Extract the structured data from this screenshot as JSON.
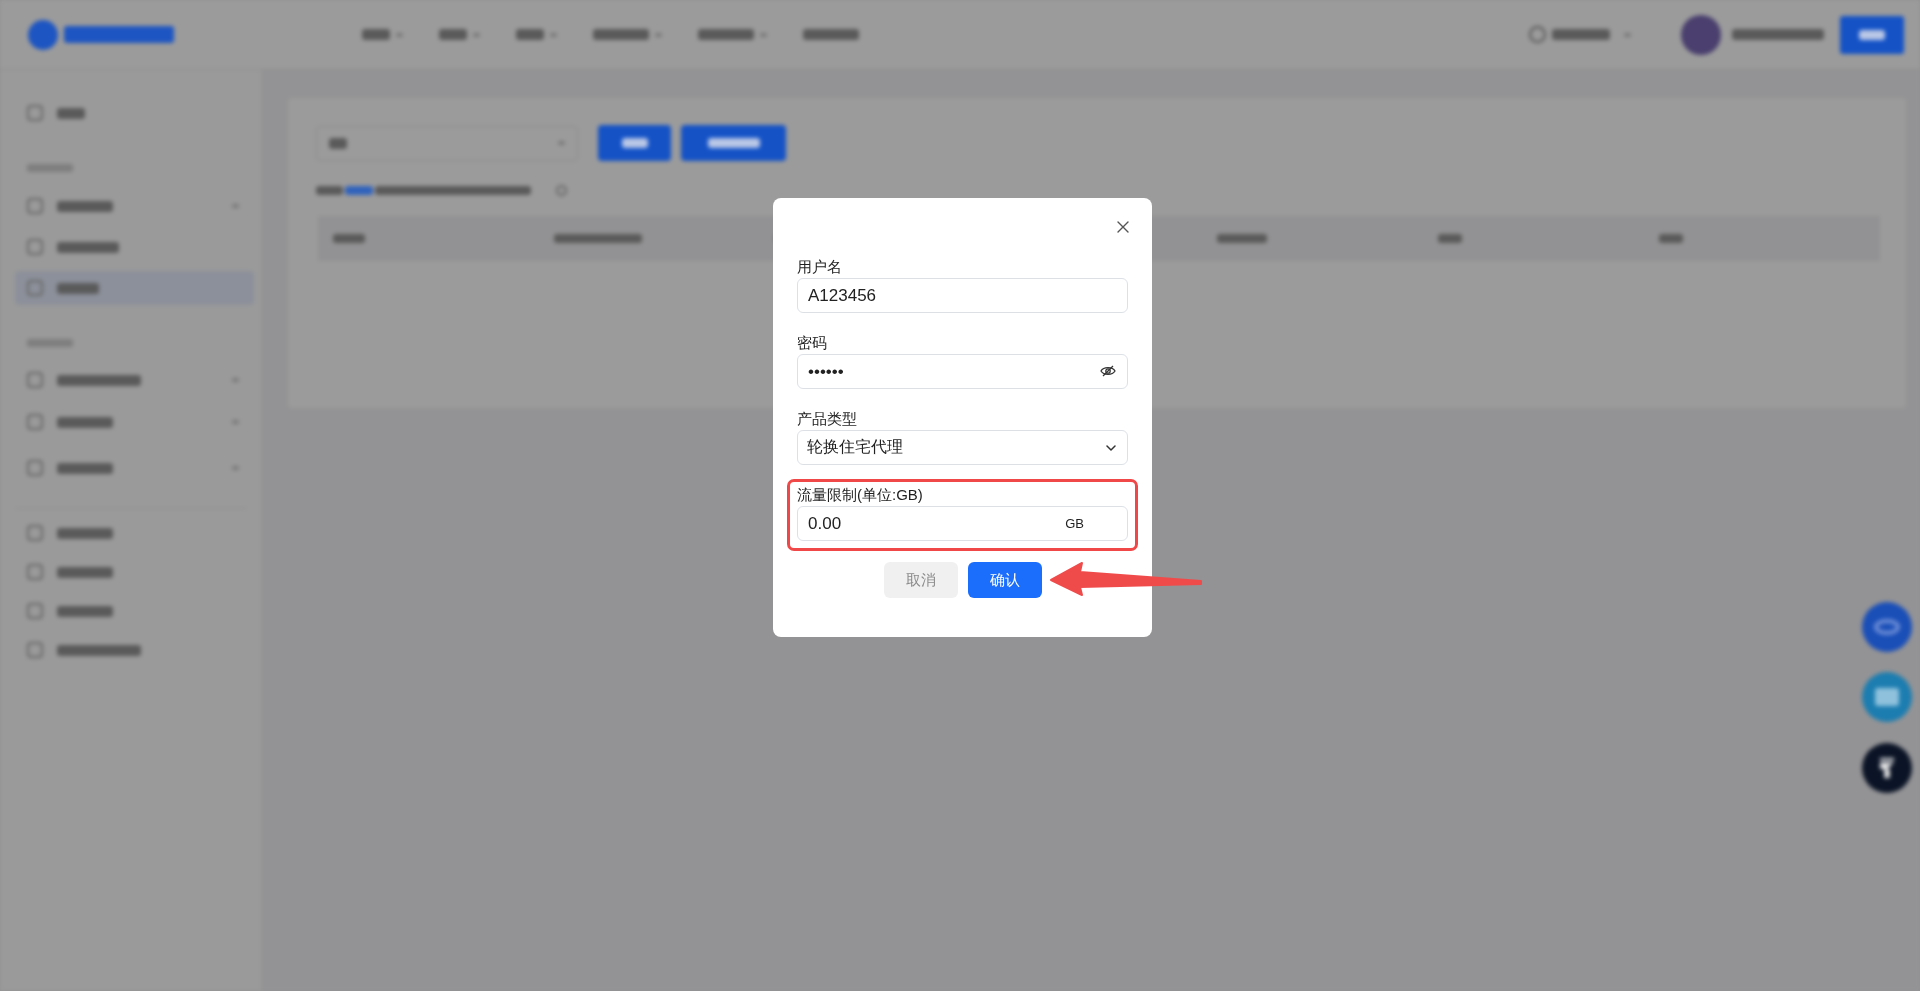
{
  "dialog": {
    "fields": [
      {
        "kind": "text",
        "label": "用户名",
        "value": "A123456",
        "highlighted": false
      },
      {
        "kind": "password",
        "label": "密码",
        "value": "••••••",
        "revealed": false,
        "highlighted": false
      },
      {
        "kind": "select",
        "label": "产品类型",
        "value": "轮换住宅代理",
        "highlighted": false
      },
      {
        "kind": "unit",
        "label": "流量限制(单位:GB)",
        "value": "0.00",
        "unit": "GB",
        "highlighted": true
      }
    ],
    "buttons": [
      {
        "kind": "secondary",
        "label": "取消",
        "pointed": false
      },
      {
        "kind": "primary",
        "label": "确认",
        "pointed": true
      }
    ]
  }
}
